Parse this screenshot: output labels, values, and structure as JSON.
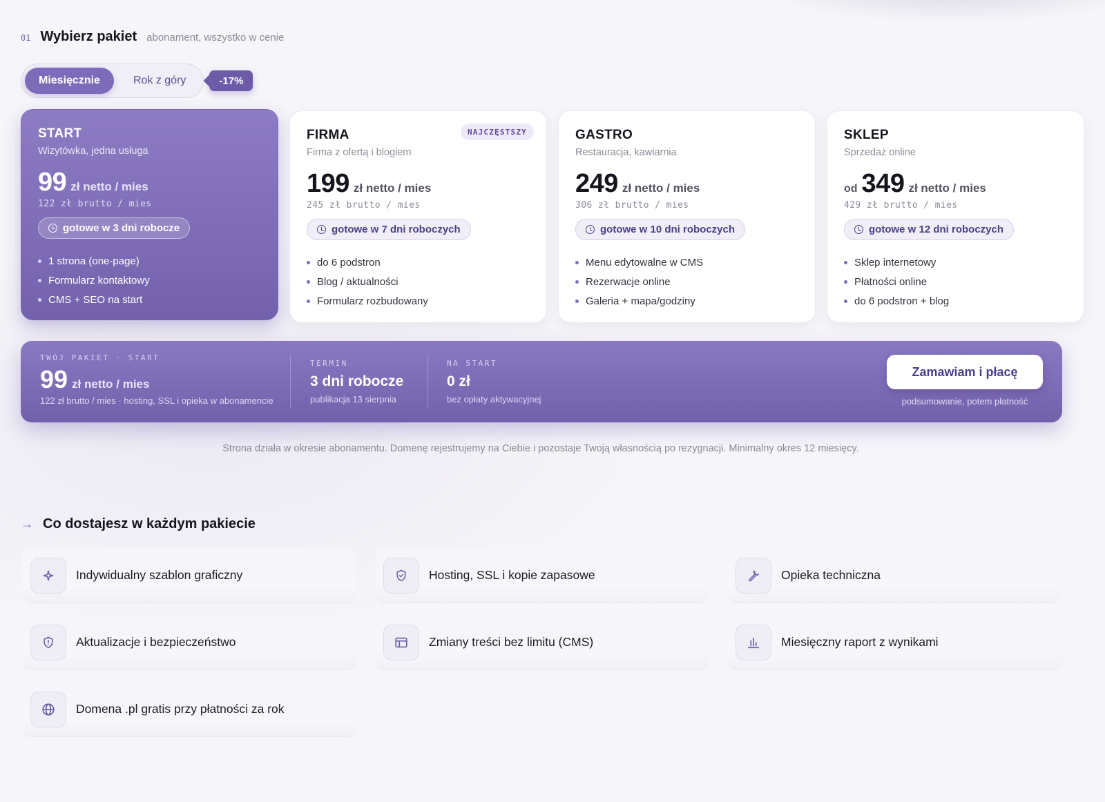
{
  "header": {
    "number": "01",
    "title": "Wybierz pakiet",
    "subtitle": "abonament, wszystko w cenie"
  },
  "billing": {
    "monthly": "Miesięcznie",
    "yearly": "Rok z góry",
    "discount": "-17%",
    "selected": "monthly"
  },
  "plans": [
    {
      "name": "START",
      "desc": "Wizytówka, jedna usługa",
      "prefix": "",
      "price": "99",
      "unit": "zł netto / mies",
      "gross": "122 zł brutto / mies",
      "ready": "gotowe w 3 dni robocze",
      "features": [
        "1 strona (one-page)",
        "Formularz kontaktowy",
        "CMS + SEO na start"
      ],
      "selected": true,
      "badge": ""
    },
    {
      "name": "FIRMA",
      "desc": "Firma z ofertą i blogiem",
      "prefix": "",
      "price": "199",
      "unit": "zł netto / mies",
      "gross": "245 zł brutto / mies",
      "ready": "gotowe w 7 dni roboczych",
      "features": [
        "do 6 podstron",
        "Blog / aktualności",
        "Formularz rozbudowany"
      ],
      "selected": false,
      "badge": "NAJCZĘSTSZY"
    },
    {
      "name": "GASTRO",
      "desc": "Restauracja, kawiarnia",
      "prefix": "",
      "price": "249",
      "unit": "zł netto / mies",
      "gross": "306 zł brutto / mies",
      "ready": "gotowe w 10 dni roboczych",
      "features": [
        "Menu edytowalne w CMS",
        "Rezerwacje online",
        "Galeria + mapa/godziny"
      ],
      "selected": false,
      "badge": ""
    },
    {
      "name": "SKLEP",
      "desc": "Sprzedaż online",
      "prefix": "od",
      "price": "349",
      "unit": "zł netto / mies",
      "gross": "429 zł brutto / mies",
      "ready": "gotowe w 12 dni roboczych",
      "features": [
        "Sklep internetowy",
        "Płatności online",
        "do 6 podstron + blog"
      ],
      "selected": false,
      "badge": ""
    }
  ],
  "summary": {
    "package_label": "TWÓJ PAKIET · START",
    "price": "99",
    "unit": "zł netto / mies",
    "price_note": "122 zł brutto / mies · hosting, SSL i opieka w abonamencie",
    "term_label": "TERMIN",
    "term_value": "3 dni robocze",
    "term_note": "publikacja 13 sierpnia",
    "start_label": "NA START",
    "start_value": "0 zł",
    "start_note": "bez opłaty aktywacyjnej",
    "order_button": "Zamawiam i płacę",
    "order_note": "podsumowanie, potem płatność"
  },
  "disclaimer": "Strona działa w okresie abonamentu. Domenę rejestrujemy na Ciebie i pozostaje Twoją własnością po rezygnacji. Minimalny okres 12 miesięcy.",
  "included": {
    "arrow": "→",
    "title": "Co dostajesz w każdym pakiecie",
    "items": [
      {
        "label": "Indywidualny szablon graficzny",
        "icon": "sparkle-icon"
      },
      {
        "label": "Hosting, SSL i kopie zapasowe",
        "icon": "shield-check-icon"
      },
      {
        "label": "Opieka techniczna",
        "icon": "wrench-icon"
      },
      {
        "label": "Aktualizacje i bezpieczeństwo",
        "icon": "shield-alert-icon"
      },
      {
        "label": "Zmiany treści bez limitu (CMS)",
        "icon": "layout-icon"
      },
      {
        "label": "Miesięczny raport z wynikami",
        "icon": "bar-chart-icon"
      },
      {
        "label": "Domena .pl gratis przy płatności za rok",
        "icon": "globe-icon"
      }
    ]
  },
  "colors": {
    "accent": "#7d6bb9",
    "accent_dark": "#6e5ba8"
  }
}
